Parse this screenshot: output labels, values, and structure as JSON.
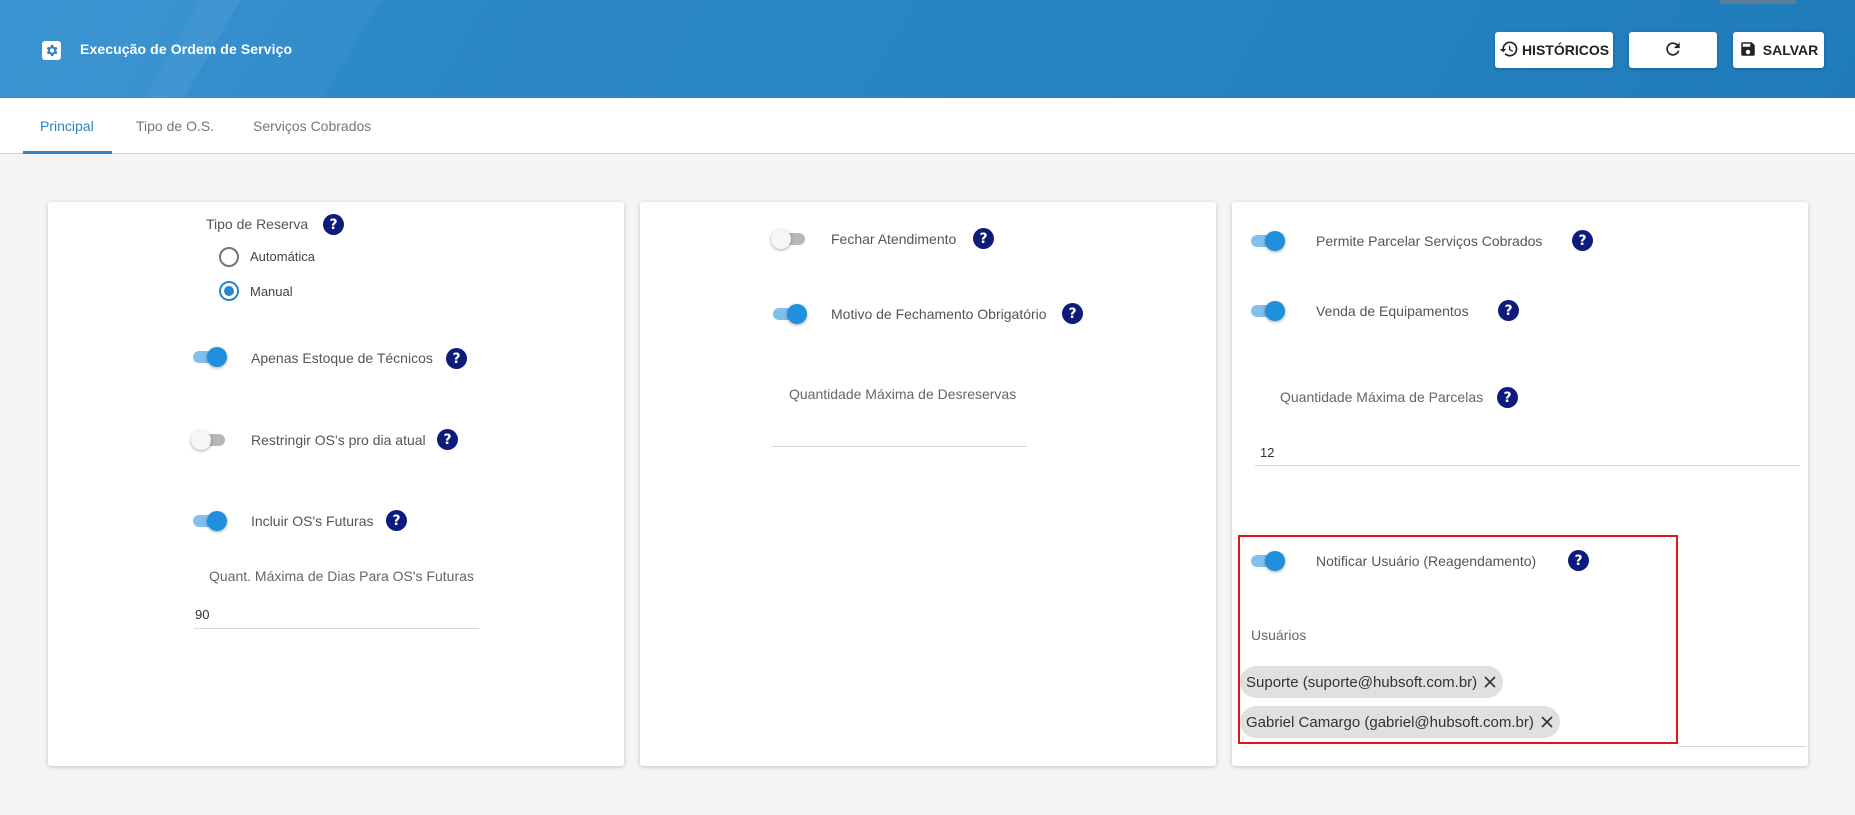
{
  "header": {
    "title": "Execução de Ordem de Serviço",
    "buttons": {
      "historicos": "HISTÓRICOS",
      "salvar": "SALVAR"
    },
    "icons": {
      "app": "gear-icon",
      "historicos": "history-icon",
      "refresh": "refresh-icon",
      "save": "floppy-disk-icon"
    }
  },
  "tabs": [
    {
      "label": "Principal",
      "active": true
    },
    {
      "label": "Tipo de O.S.",
      "active": false
    },
    {
      "label": "Serviços Cobrados",
      "active": false
    }
  ],
  "card1": {
    "tipo_reserva": {
      "label": "Tipo de Reserva",
      "options": [
        {
          "label": "Automática",
          "checked": false
        },
        {
          "label": "Manual",
          "checked": true
        }
      ]
    },
    "apenas_estoque": {
      "label": "Apenas Estoque de Técnicos",
      "on": true
    },
    "restringir_os": {
      "label": "Restringir OS's pro dia atual",
      "on": false
    },
    "incluir_futuras": {
      "label": "Incluir OS's Futuras",
      "on": true
    },
    "quant_max_dias": {
      "label": "Quant. Máxima de Dias Para OS's Futuras",
      "value": "90"
    }
  },
  "card2": {
    "fechar_atendimento": {
      "label": "Fechar Atendimento",
      "on": false
    },
    "motivo_fechamento": {
      "label": "Motivo de Fechamento Obrigatório",
      "on": true
    },
    "qtd_max_desreservas": {
      "label": "Quantidade Máxima de Desreservas",
      "value": ""
    }
  },
  "card3": {
    "permite_parcelar": {
      "label": "Permite Parcelar Serviços Cobrados",
      "on": true
    },
    "venda_equipamentos": {
      "label": "Venda de Equipamentos",
      "on": true
    },
    "qtd_max_parcelas": {
      "label": "Quantidade Máxima de Parcelas",
      "value": "12"
    },
    "notificar_usuario": {
      "label": "Notificar Usuário (Reagendamento)",
      "on": true
    },
    "usuarios": {
      "label": "Usuários",
      "chips": [
        "Suporte (suporte@hubsoft.com.br)",
        "Gabriel Camargo (gabriel@hubsoft.com.br)"
      ]
    }
  },
  "colors": {
    "header": "#2a86c6",
    "accent": "#1e90de",
    "help": "#0d1b7a",
    "highlight": "#e3151a"
  }
}
